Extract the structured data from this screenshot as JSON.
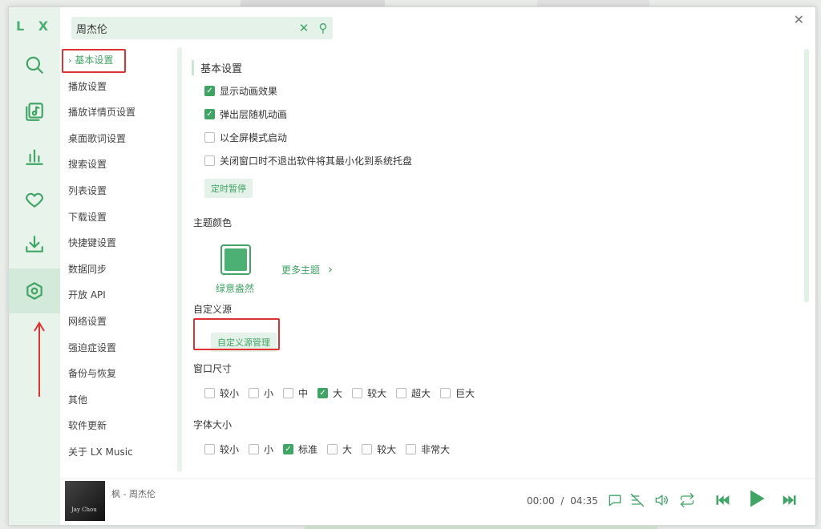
{
  "app": {
    "logo": "L X",
    "close_glyph": "✕"
  },
  "search": {
    "value": "周杰伦",
    "clear_glyph": "✕",
    "search_glyph": "⚲"
  },
  "rail": [
    {
      "name": "search-icon"
    },
    {
      "name": "music-library-icon"
    },
    {
      "name": "chart-icon"
    },
    {
      "name": "heart-icon"
    },
    {
      "name": "download-icon"
    },
    {
      "name": "settings-icon",
      "active": true
    }
  ],
  "nav": {
    "items": [
      "基本设置",
      "播放设置",
      "播放详情页设置",
      "桌面歌词设置",
      "搜索设置",
      "列表设置",
      "下载设置",
      "快捷键设置",
      "数据同步",
      "开放 API",
      "网络设置",
      "强迫症设置",
      "备份与恢复",
      "其他",
      "软件更新",
      "关于 LX Music"
    ],
    "active_index": 0,
    "chevron": "›"
  },
  "basic": {
    "title": "基本设置",
    "checkboxes": [
      {
        "label": "显示动画效果",
        "checked": true
      },
      {
        "label": "弹出层随机动画",
        "checked": true
      },
      {
        "label": "以全屏模式启动",
        "checked": false
      },
      {
        "label": "关闭窗口时不退出软件将其最小化到系统托盘",
        "checked": false
      }
    ],
    "timer_button": "定时暂停"
  },
  "theme": {
    "title": "主题颜色",
    "current_name": "绿意盎然",
    "more_label": "更多主题",
    "more_chevron": "›",
    "color": "#4caf73"
  },
  "custom_source": {
    "title": "自定义源",
    "button": "自定义源管理"
  },
  "window_size": {
    "title": "窗口尺寸",
    "options": [
      {
        "label": "较小",
        "checked": false
      },
      {
        "label": "小",
        "checked": false
      },
      {
        "label": "中",
        "checked": false
      },
      {
        "label": "大",
        "checked": true
      },
      {
        "label": "较大",
        "checked": false
      },
      {
        "label": "超大",
        "checked": false
      },
      {
        "label": "巨大",
        "checked": false
      }
    ]
  },
  "font_size": {
    "title": "字体大小",
    "options": [
      {
        "label": "较小",
        "checked": false
      },
      {
        "label": "小",
        "checked": false
      },
      {
        "label": "标准",
        "checked": true
      },
      {
        "label": "大",
        "checked": false
      },
      {
        "label": "较大",
        "checked": false
      },
      {
        "label": "非常大",
        "checked": false
      }
    ]
  },
  "player": {
    "song": "枫 - 周杰伦",
    "cover_text": "Jay Chou",
    "current_time": "00:00",
    "separator": "/",
    "duration": "04:35"
  },
  "colors": {
    "accent": "#3fa464",
    "rail_bg": "#e8f3ec",
    "highlight_box": "#e03131"
  }
}
